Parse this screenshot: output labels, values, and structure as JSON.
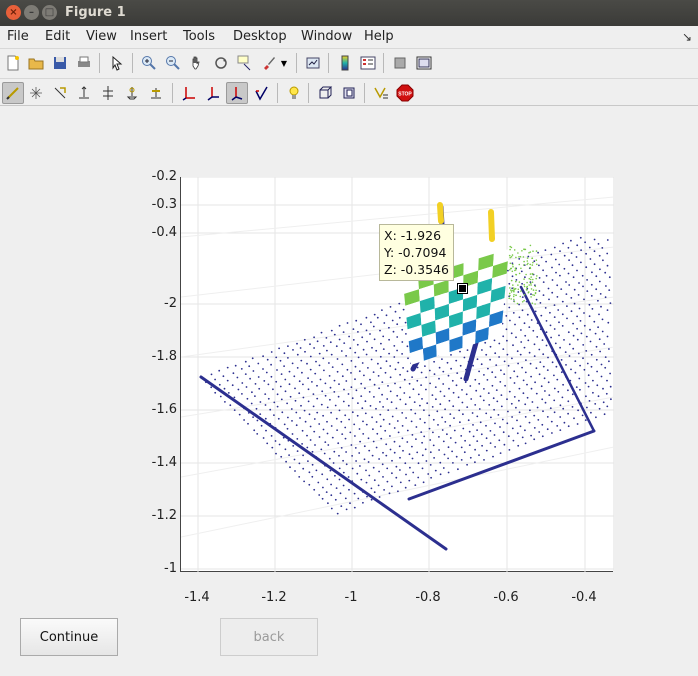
{
  "window": {
    "title": "Figure 1"
  },
  "menu": [
    {
      "label": "File"
    },
    {
      "label": "Edit"
    },
    {
      "label": "View"
    },
    {
      "label": "Insert"
    },
    {
      "label": "Tools"
    },
    {
      "label": "Desktop"
    },
    {
      "label": "Window"
    },
    {
      "label": "Help"
    }
  ],
  "toolbar1": [
    "new-figure-icon",
    "open-file-icon",
    "save-icon",
    "print-icon",
    "edit-plot-arrow-icon",
    "zoom-in-icon",
    "zoom-out-icon",
    "pan-hand-icon",
    "rotate-3d-icon",
    "data-cursor-icon",
    "brush-icon",
    "brush-dropdown-icon",
    "link-plot-icon",
    "insert-colorbar-icon",
    "insert-legend-icon",
    "hide-plot-tools-icon",
    "show-plot-tools-icon"
  ],
  "toolbar2": [
    "select-points-icon",
    "scatter-points-icon",
    "pointer-icon",
    "align-icon",
    "distribute-icon",
    "level-icon",
    "axis-red-icon",
    "axis-red-blue-icon",
    "axis-selected-icon",
    "axis-check-icon",
    "lightbulb-icon",
    "cube-icon",
    "cube-view-icon",
    "label-icon",
    "stop-icon"
  ],
  "chart_data": {
    "type": "scatter",
    "title": "",
    "xlabel": "",
    "ylabel": "",
    "x_ticks": [
      "-1.4",
      "-1.2",
      "-1",
      "-0.8",
      "-0.6",
      "-0.4"
    ],
    "y_ticks": [
      "-1",
      "-1.2",
      "-1.4",
      "-1.6",
      "-1.8",
      "-2",
      "-0.4",
      "-0.3",
      "-0.2"
    ],
    "grid": true,
    "colormap": [
      "#2c2f8f",
      "#1f78c8",
      "#20b2aa",
      "#7ac94a",
      "#f2d024"
    ],
    "datatip": {
      "x": "X: -1.926",
      "y": "Y: -0.7094",
      "z": "Z: -0.3546"
    }
  },
  "buttons": {
    "continue": "Continue",
    "back": "back"
  },
  "colors": {
    "accent": "#e8603a",
    "points_dark": "#2c2f8f",
    "tooltip_bg": "#ffffe0"
  }
}
